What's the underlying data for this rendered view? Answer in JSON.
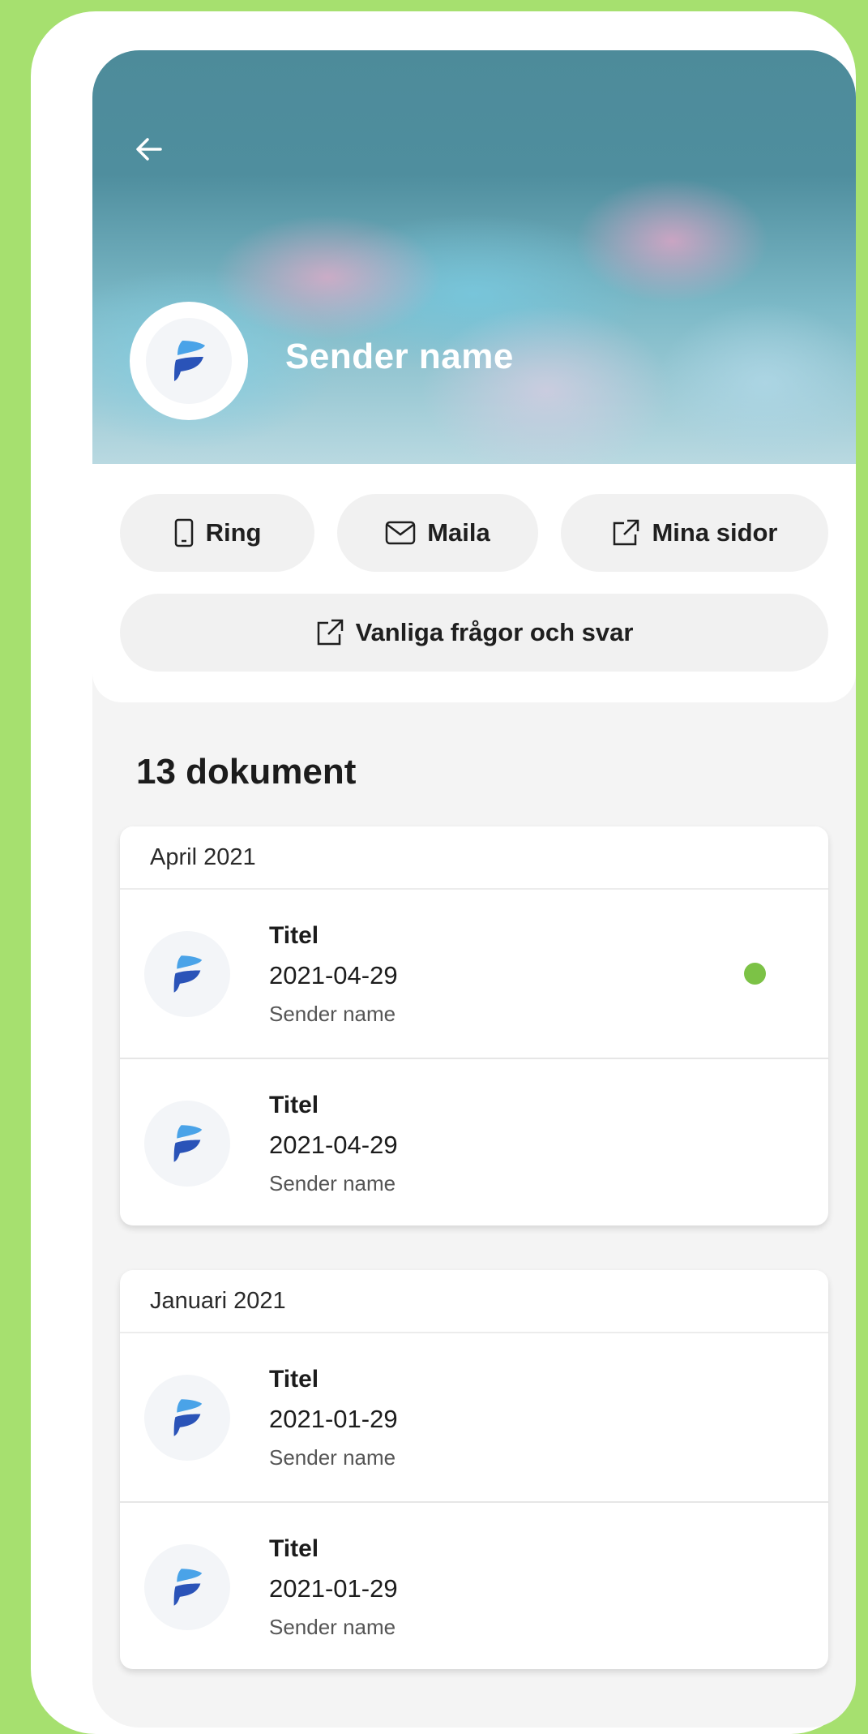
{
  "header": {
    "sender_name": "Sender name"
  },
  "actions": {
    "ring_label": "Ring",
    "mail_label": "Maila",
    "pages_label": "Mina sidor",
    "faq_label": "Vanliga frågor och svar"
  },
  "documents": {
    "count_label": "13 dokument",
    "groups": [
      {
        "month": "April 2021",
        "items": [
          {
            "title": "Titel",
            "date": "2021-04-29",
            "sender": "Sender name",
            "unread": true
          },
          {
            "title": "Titel",
            "date": "2021-04-29",
            "sender": "Sender name",
            "unread": false
          }
        ]
      },
      {
        "month": "Januari 2021",
        "items": [
          {
            "title": "Titel",
            "date": "2021-01-29",
            "sender": "Sender name",
            "unread": false
          },
          {
            "title": "Titel",
            "date": "2021-01-29",
            "sender": "Sender name",
            "unread": false
          }
        ]
      }
    ]
  },
  "colors": {
    "background": "#a6e06f",
    "unread_dot": "#7cc246",
    "logo_light": "#4aa3e8",
    "logo_dark": "#2a53b8"
  },
  "icons": {
    "back": "arrow-left-icon",
    "phone": "phone-icon",
    "mail": "mail-icon",
    "external": "external-link-icon",
    "logo": "sender-logo-icon"
  }
}
